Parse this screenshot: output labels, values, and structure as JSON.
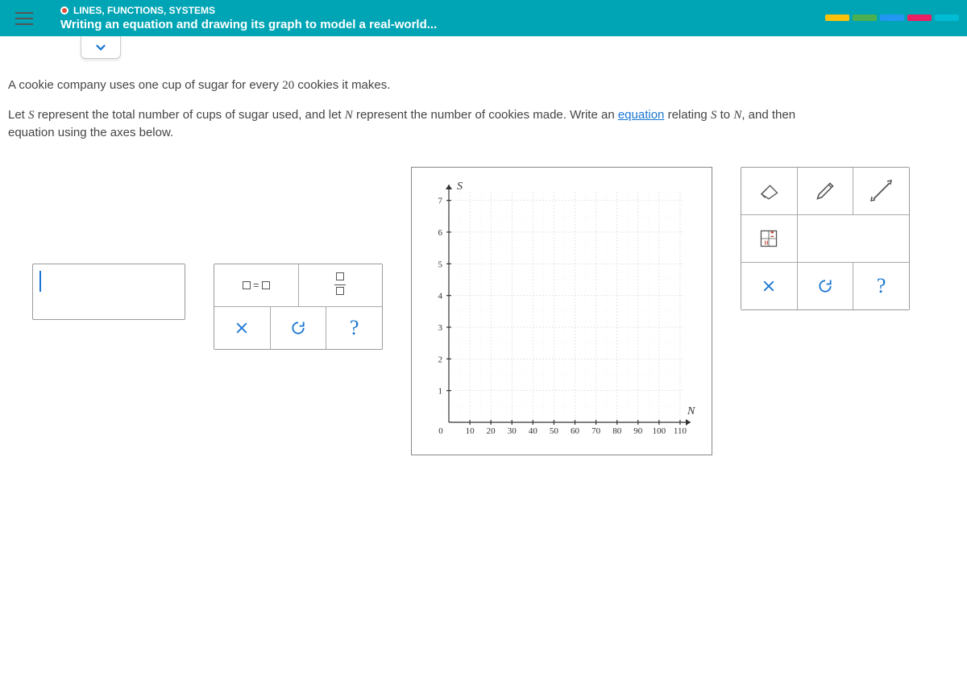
{
  "header": {
    "breadcrumb": "LINES, FUNCTIONS, SYSTEMS",
    "title": "Writing an equation and drawing its graph to model a real-world..."
  },
  "problem": {
    "line1_a": "A cookie company uses one cup of sugar for every ",
    "line1_num": "20",
    "line1_b": " cookies it makes.",
    "line2_a": "Let ",
    "line2_var1": "S",
    "line2_b": " represent the total number of cups of sugar used, and let ",
    "line2_var2": "N",
    "line2_c": " represent the number of cookies made. Write an ",
    "line2_link": "equation",
    "line2_d": " relating ",
    "line2_var3": "S",
    "line2_e": " to ",
    "line2_var4": "N",
    "line2_f": ", and then",
    "line3": "equation using the axes below."
  },
  "keypad": {
    "eq_label": "☐=☐",
    "clear": "✕",
    "redo": "↻",
    "help": "?"
  },
  "graph_tools": {
    "clear": "✕",
    "redo": "↻",
    "help": "?"
  },
  "chart_data": {
    "type": "scatter",
    "title": "",
    "xlabel": "N",
    "ylabel": "S",
    "x_ticks": [
      0,
      10,
      20,
      30,
      40,
      50,
      60,
      70,
      80,
      90,
      100,
      110
    ],
    "y_ticks": [
      1,
      2,
      3,
      4,
      5,
      6,
      7
    ],
    "xlim": [
      0,
      115
    ],
    "ylim": [
      0,
      7.5
    ],
    "series": [],
    "x_origin_label": "0"
  }
}
